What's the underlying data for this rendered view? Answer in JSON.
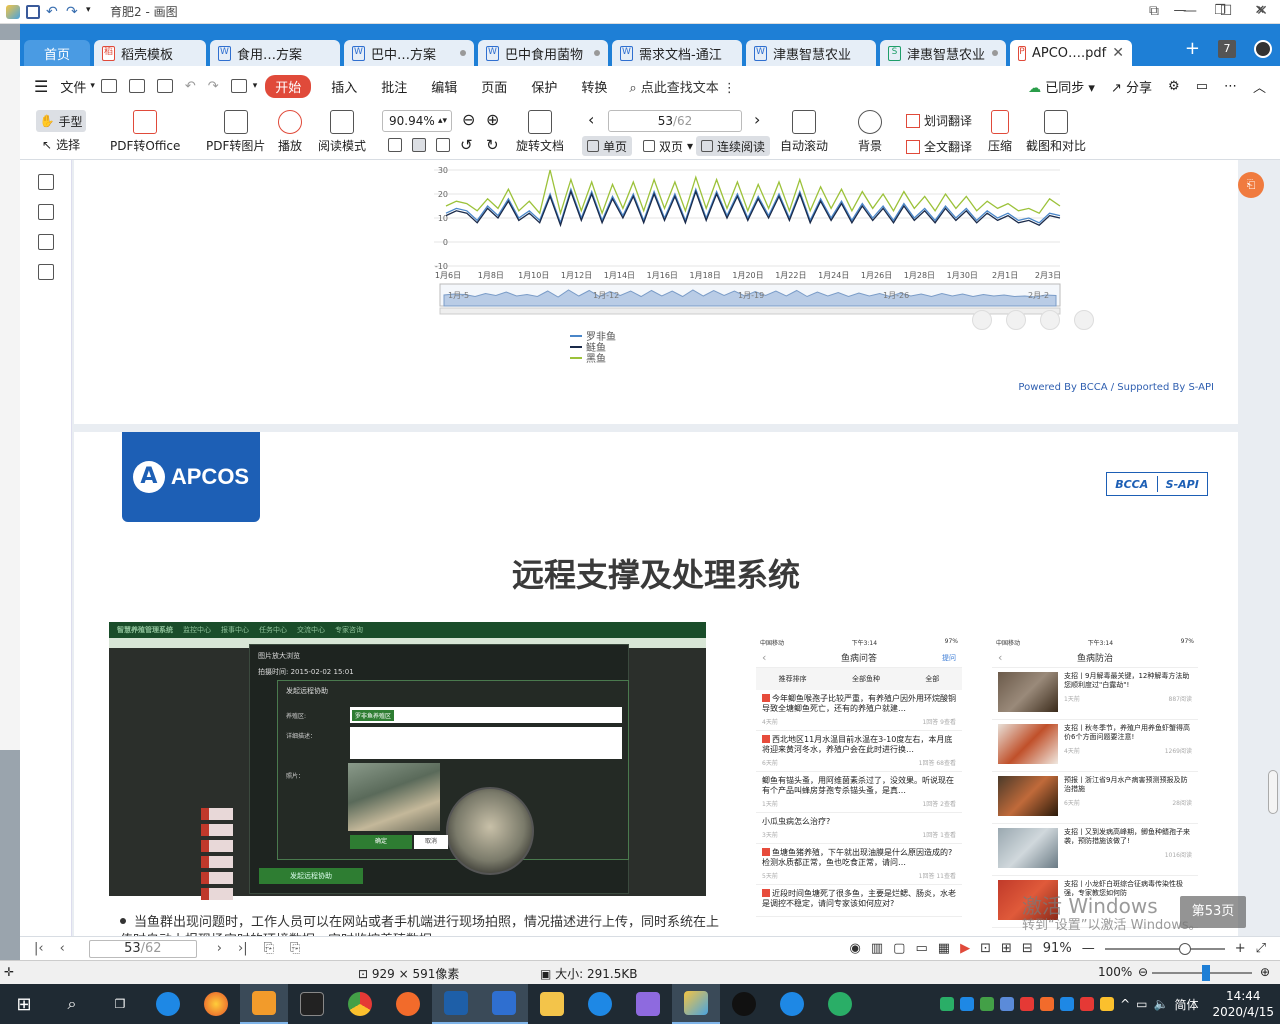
{
  "paint": {
    "title": "育肥2 - 画图",
    "status": {
      "dimensions": "929 × 591像素",
      "size": "大小: 291.5KB",
      "zoom": "100%"
    }
  },
  "wps": {
    "tabs": [
      {
        "label": "首页",
        "type": "home"
      },
      {
        "label": "稻壳模板",
        "icon": "稻"
      },
      {
        "label": "食用…方案",
        "icon": "W"
      },
      {
        "label": "巴中…方案",
        "icon": "W"
      },
      {
        "label": "巴中食用菌物",
        "icon": "W"
      },
      {
        "label": "需求文档-通江",
        "icon": "W"
      },
      {
        "label": "津惠智慧农业",
        "icon": "W"
      },
      {
        "label": "津惠智慧农业",
        "icon": "S"
      },
      {
        "label": "APCO….pdf",
        "icon": "P",
        "active": true
      }
    ],
    "tab_count": "7",
    "menu": {
      "file": "文件",
      "items": [
        "开始",
        "插入",
        "批注",
        "编辑",
        "页面",
        "保护",
        "转换"
      ],
      "active": "开始",
      "search": "点此查找文本",
      "synced": "已同步",
      "share": "分享"
    },
    "toolbar": {
      "hand": "手型",
      "select": "选择",
      "pdf_to_office": "PDF转Office",
      "pdf_to_image": "PDF转图片",
      "play": "播放",
      "read_mode": "阅读模式",
      "zoom": "90.94%",
      "rotate": "旋转文档",
      "page_current": "53",
      "page_total": "/62",
      "single": "单页",
      "double": "双页",
      "continuous": "连续阅读",
      "auto_scroll": "自动滚动",
      "background": "背景",
      "translate_word": "划词翻译",
      "translate_full": "全文翻译",
      "compress": "压缩",
      "screenshot_compare": "截图和对比"
    },
    "statusbar": {
      "page_current": "53",
      "page_total": "/62",
      "zoom": "91%"
    },
    "page_toast": "第53页"
  },
  "page1": {
    "chart_data": {
      "type": "line",
      "y_ticks": [
        "30",
        "20",
        "10",
        "0",
        "-10"
      ],
      "x_ticks": [
        "1月6日",
        "1月8日",
        "1月10日",
        "1月12日",
        "1月14日",
        "1月16日",
        "1月18日",
        "1月20日",
        "1月22日",
        "1月24日",
        "1月26日",
        "1月28日",
        "1月30日",
        "2月1日",
        "2月3日"
      ],
      "navigator_labels": [
        "1月-5",
        "1月-12",
        "1月-19",
        "1月-26",
        "2月-2"
      ],
      "ylim": [
        -10,
        30
      ],
      "series": [
        {
          "name": "罗非鱼",
          "color": "#4a86c8",
          "values": [
            12,
            14,
            13,
            9,
            15,
            11,
            18,
            10,
            13,
            9,
            20,
            8,
            22,
            10,
            21,
            9,
            19,
            11,
            20,
            9,
            21,
            10,
            20,
            9,
            22,
            10,
            21,
            11,
            20,
            10,
            19,
            11,
            20,
            10,
            21,
            9,
            18,
            10,
            17,
            9,
            16,
            10,
            15,
            9,
            16,
            10,
            14,
            9,
            15,
            10,
            14,
            9,
            13,
            10,
            12,
            9,
            10,
            8,
            12,
            11
          ]
        },
        {
          "name": "鲢鱼",
          "color": "#1a2a4a",
          "values": [
            11,
            13,
            12,
            8,
            14,
            10,
            17,
            9,
            12,
            8,
            19,
            7,
            21,
            9,
            20,
            8,
            18,
            10,
            19,
            8,
            20,
            9,
            19,
            8,
            21,
            9,
            20,
            10,
            19,
            9,
            18,
            10,
            19,
            9,
            20,
            8,
            17,
            9,
            16,
            8,
            15,
            9,
            14,
            8,
            15,
            9,
            13,
            8,
            14,
            9,
            13,
            8,
            12,
            9,
            11,
            8,
            9,
            7,
            11,
            10
          ]
        },
        {
          "name": "黑鱼",
          "color": "#9cc23a",
          "values": [
            15,
            17,
            16,
            13,
            18,
            14,
            22,
            13,
            17,
            12,
            30,
            12,
            26,
            13,
            25,
            12,
            24,
            14,
            25,
            13,
            26,
            14,
            25,
            13,
            27,
            14,
            26,
            14,
            25,
            13,
            24,
            14,
            25,
            13,
            26,
            13,
            23,
            14,
            22,
            13,
            21,
            14,
            20,
            13,
            21,
            14,
            19,
            13,
            20,
            14,
            19,
            13,
            17,
            14,
            16,
            13,
            14,
            12,
            18,
            15
          ]
        }
      ]
    },
    "powered": "Powered By BCCA / Supported By S-API"
  },
  "page2": {
    "logo_text": "APCOS",
    "bcca": "BCCA",
    "sapi": "S-API",
    "title": "远程支撑及处理系统",
    "screenshot": {
      "app_name": "智慧养殖管理系统",
      "nav": [
        "监控中心",
        "报事中心",
        "任务中心",
        "交流中心",
        "专家咨询"
      ],
      "dialog1_title": "图片放大浏览",
      "capture_time": "拍摄时间: 2015-02-02 15:01",
      "dialog2_title": "发起远程协助",
      "farm_label": "养殖区:",
      "farm_value": "罗非鱼养殖区",
      "desc_label": "详细描述：",
      "photo_label": "照片：",
      "ok": "确定",
      "cancel": "取消",
      "big_button": "发起远程协助"
    },
    "phone1": {
      "carrier": "中国移动",
      "time": "下午3:14",
      "battery": "97%",
      "title": "鱼病问答",
      "ask": "提问",
      "filters": [
        "推荐排序",
        "全部鱼种",
        "全部"
      ],
      "items": [
        {
          "q": "今年鲫鱼喉孢子比较严重，有养殖户因外用环烷酸铜导致全塘鲫鱼死亡，还有的养殖户就建…",
          "t": "4天前",
          "meta": "1回答  9查看",
          "hot": true
        },
        {
          "q": "西北地区11月水温目前水温在3-10度左右，本月底将迎来黄河冬水，养殖户会在此时进行换…",
          "t": "6天前",
          "meta": "1回答  68查看",
          "hot": true
        },
        {
          "q": "鲫鱼有锚头蚤，用阿维菌素杀过了，没效果。听说现在有个产品叫蜂房芽孢专杀锚头蚤，是真…",
          "t": "1天前",
          "meta": "1回答  2查看",
          "hot": false
        },
        {
          "q": "小瓜虫病怎么治疗?",
          "t": "3天前",
          "meta": "1回答  1查看",
          "hot": false
        },
        {
          "q": "鱼塘鱼猪养殖，下午就出现油膜是什么原因造成的? 检测水质都正常，鱼也吃食正常，请问…",
          "t": "5天前",
          "meta": "1回答  11查看",
          "hot": true
        },
        {
          "q": "近段时间鱼塘死了很多鱼，主要是烂鳃、肠炎，水老是调控不稳定，请问专家该如何应对?",
          "t": "",
          "meta": "",
          "hot": true
        }
      ]
    },
    "phone2": {
      "carrier": "中国移动",
      "time": "下午3:14",
      "battery": "97%",
      "title": "鱼病防治",
      "items": [
        {
          "t": "支招丨9月解毒最关键，12种解毒方法助您顺利度过\"白露劫\"!",
          "d": "1天前",
          "v": "887阅读"
        },
        {
          "t": "支招丨秋冬季节，养殖户用养鱼虾蟹得高价6个方面问题要注意!",
          "d": "4天前",
          "v": "1269阅读"
        },
        {
          "t": "预报丨浙江省9月水产病害预测预报及防治措施",
          "d": "6天前",
          "v": "28阅读"
        },
        {
          "t": "支招丨又到发病高峰期，鲫鱼种鳍孢子来袭，预防措施该做了!",
          "d": "",
          "v": "1016阅读"
        },
        {
          "t": "支招丨小龙虾白斑综合征病毒传染性极强，专家教您如何防",
          "d": "",
          "v": ""
        }
      ]
    },
    "bullet": "当鱼群出现问题时，工作人员可以在网站或者手机端进行现场拍照，情况描述进行上传，同时系统在上传时自动上报现场实时的环境数据，实时监控养殖数据。"
  },
  "windows": {
    "activate": "激活 Windows",
    "activate_sub": "转到“设置”以激活 Windows。",
    "lang": "简体",
    "time": "14:44",
    "date": "2020/4/15"
  }
}
